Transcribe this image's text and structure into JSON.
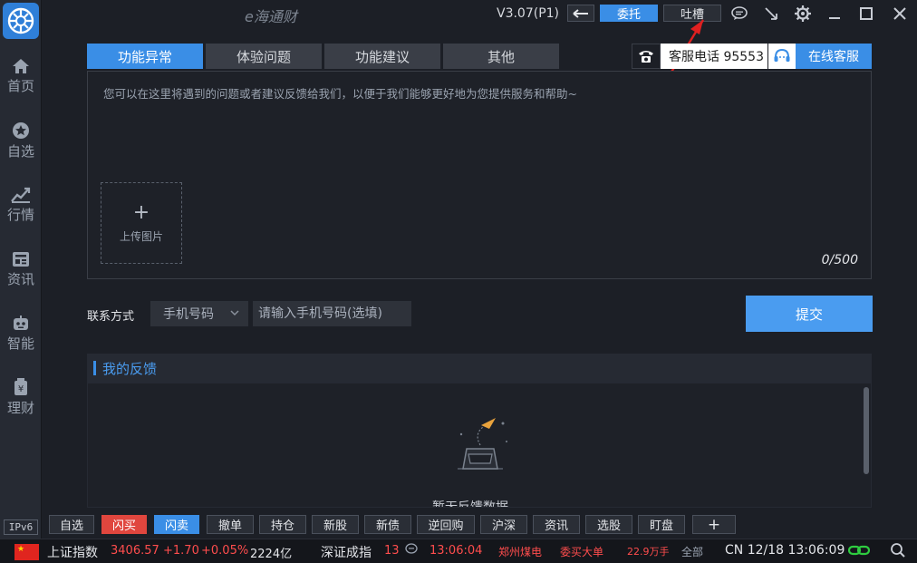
{
  "app": {
    "title": "e海通财",
    "version": "V3.07(P1)"
  },
  "titlebar": {
    "back_icon": "arrow-left-icon",
    "entrust_label": "委托",
    "complain_label": "吐槽",
    "icons": [
      "chat-icon",
      "minimize-arrow-icon",
      "gear-icon",
      "minimize-icon",
      "maximize-icon",
      "close-icon"
    ]
  },
  "sidebar": {
    "items": [
      {
        "label": "首页",
        "icon": "home-icon"
      },
      {
        "label": "自选",
        "icon": "star-icon"
      },
      {
        "label": "行情",
        "icon": "chart-icon"
      },
      {
        "label": "资讯",
        "icon": "news-icon"
      },
      {
        "label": "智能",
        "icon": "robot-icon"
      },
      {
        "label": "理财",
        "icon": "money-bag-icon"
      }
    ],
    "ipv6": "IPv6"
  },
  "tabs": [
    {
      "label": "功能异常",
      "active": true
    },
    {
      "label": "体验问题",
      "active": false
    },
    {
      "label": "功能建议",
      "active": false
    },
    {
      "label": "其他",
      "active": false
    }
  ],
  "support": {
    "phone_label": "客服电话 95553",
    "online_label": "在线客服"
  },
  "feedback": {
    "placeholder": "您可以在这里将遇到的问题或者建议反馈给我们，以便于我们能够更好地为您提供服务和帮助~",
    "upload_label": "上传图片",
    "counter": "0/500"
  },
  "contact": {
    "label": "联系方式",
    "method": "手机号码",
    "input_placeholder": "请输入手机号码(选填)",
    "submit_label": "提交"
  },
  "my_feedback": {
    "title": "我的反馈",
    "empty_text": "暂无反馈数据"
  },
  "bottom_toolbar": [
    {
      "label": "自选",
      "style": "normal"
    },
    {
      "label": "闪买",
      "style": "red"
    },
    {
      "label": "闪卖",
      "style": "blue"
    },
    {
      "label": "撤单",
      "style": "normal"
    },
    {
      "label": "持仓",
      "style": "normal"
    },
    {
      "label": "新股",
      "style": "normal"
    },
    {
      "label": "新债",
      "style": "normal"
    },
    {
      "label": "逆回购",
      "style": "normal"
    },
    {
      "label": "沪深",
      "style": "normal"
    },
    {
      "label": "资讯",
      "style": "normal"
    },
    {
      "label": "选股",
      "style": "normal"
    },
    {
      "label": "盯盘",
      "style": "normal"
    },
    {
      "label": "+",
      "style": "normal"
    }
  ],
  "status": {
    "index1_name": "上证指数",
    "index1_value": "3406.57",
    "index1_change": "+1.70",
    "index1_pct": "+0.05%",
    "index1_volume": "2224亿",
    "index2_name": "深证成指",
    "index2_value_partial": "13",
    "time": "13:06:04",
    "news1": "郑州煤电",
    "news2": "委买大单",
    "amount": "22.9万手",
    "filter": "全部",
    "datetime": "CN 12/18 13:06:09"
  },
  "colors": {
    "accent": "#3a8ee6",
    "up": "#ff4d4d",
    "down": "#e0463e",
    "warning": "#ffb300"
  }
}
